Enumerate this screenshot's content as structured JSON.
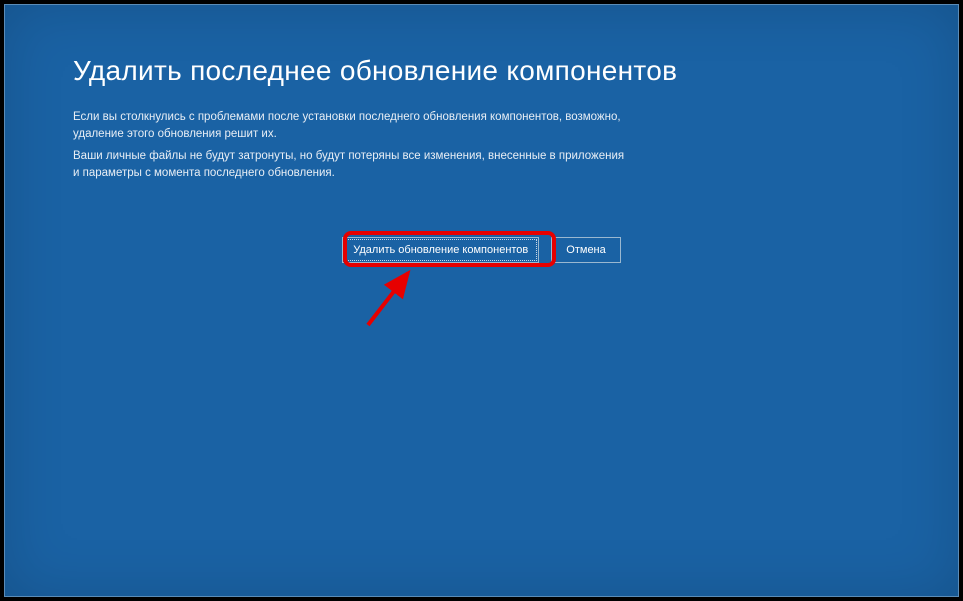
{
  "heading": "Удалить последнее обновление компонентов",
  "description1": "Если вы столкнулись с проблемами после установки последнего обновления компонентов, возможно, удаление этого обновления решит их.",
  "description2": "Ваши личные файлы не будут затронуты, но будут потеряны все изменения, внесенные в приложения и параметры с момента последнего обновления.",
  "buttons": {
    "primary": "Удалить обновление компонентов",
    "cancel": "Отмена"
  }
}
